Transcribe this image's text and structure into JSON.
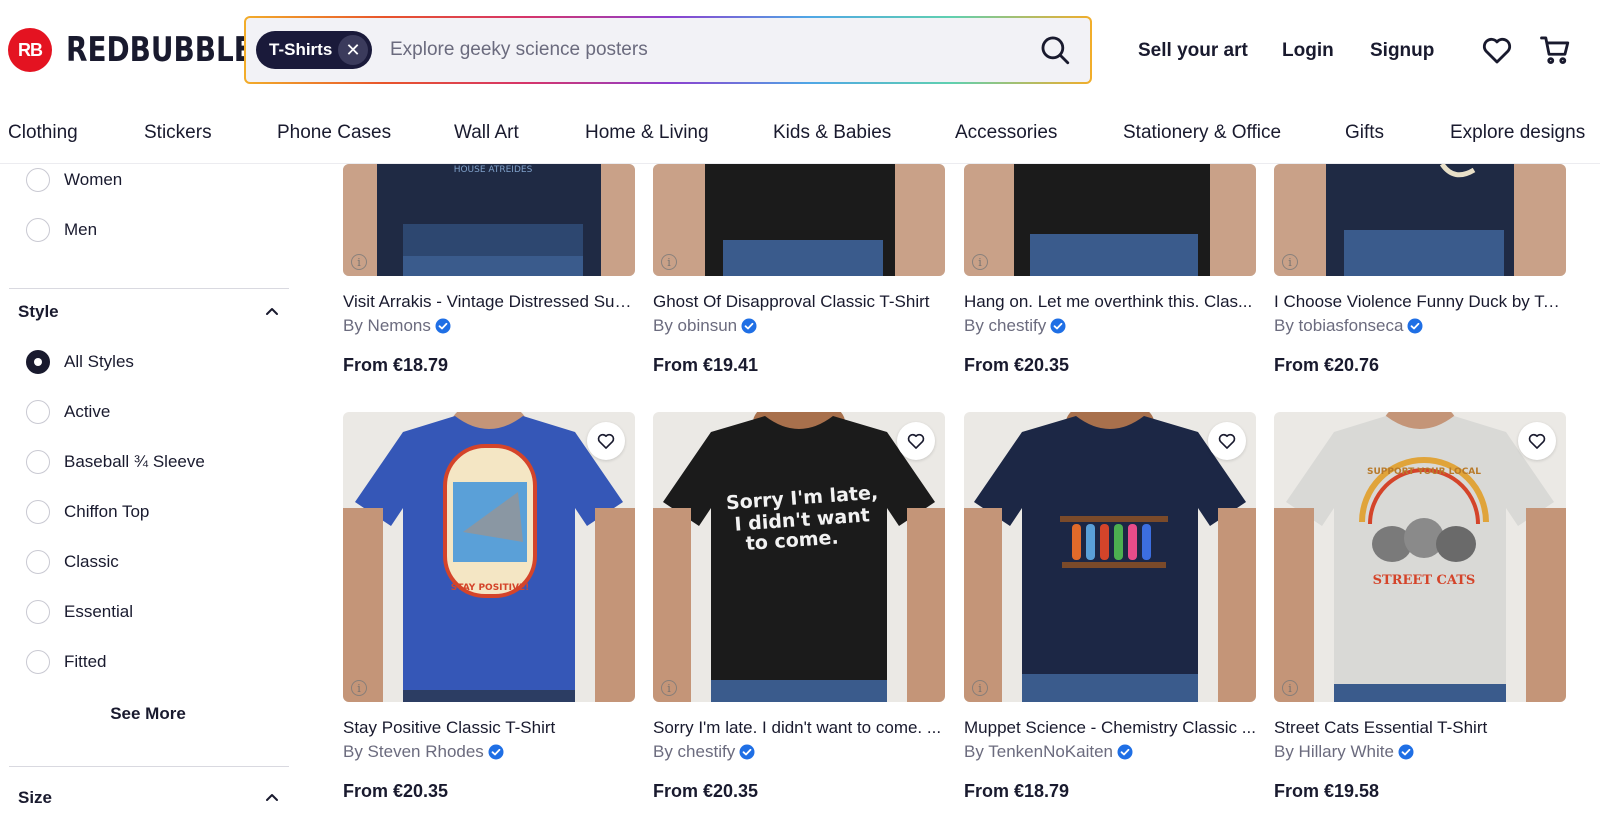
{
  "brand": {
    "logo_mark": "RB",
    "name": "REDBUBBLE",
    "color": "#e41321"
  },
  "search": {
    "chip_label": "T-Shirts",
    "placeholder": "Explore geeky science posters",
    "value": ""
  },
  "header_links": {
    "sell": "Sell your art",
    "login": "Login",
    "signup": "Signup"
  },
  "header_icons": [
    "heart-icon",
    "cart-icon"
  ],
  "categories": [
    "Clothing",
    "Stickers",
    "Phone Cases",
    "Wall Art",
    "Home & Living",
    "Kids & Babies",
    "Accessories",
    "Stationery & Office",
    "Gifts",
    "Explore designs"
  ],
  "sidebar": {
    "gender_options": [
      {
        "label": "Women",
        "checked": false
      },
      {
        "label": "Men",
        "checked": false
      }
    ],
    "style_section": {
      "title": "Style",
      "options": [
        {
          "label": "All Styles",
          "checked": true
        },
        {
          "label": "Active",
          "checked": false
        },
        {
          "label": "Baseball ¾ Sleeve",
          "checked": false
        },
        {
          "label": "Chiffon Top",
          "checked": false
        },
        {
          "label": "Classic",
          "checked": false
        },
        {
          "label": "Essential",
          "checked": false
        },
        {
          "label": "Fitted",
          "checked": false
        }
      ],
      "see_more": "See More"
    },
    "size_section": {
      "title": "Size"
    }
  },
  "products": [
    {
      "title": "Visit Arrakis - Vintage Distressed Surf...",
      "artist": "By Nemons",
      "price": "From €18.79",
      "shirt_color": "#1f2a44"
    },
    {
      "title": "Ghost Of Disapproval Classic T-Shirt",
      "artist": "By obinsun",
      "price": "From €19.41",
      "shirt_color": "#1b1b1b"
    },
    {
      "title": "Hang on. Let me overthink this. Clas...",
      "artist": "By chestify",
      "price": "From €20.35",
      "shirt_color": "#1b1b1b"
    },
    {
      "title": "I Choose Violence Funny Duck by To...",
      "artist": "By tobiasfonseca",
      "price": "From €20.76",
      "shirt_color": "#1f2a44"
    },
    {
      "title": "Stay Positive Classic T-Shirt",
      "artist": "By Steven Rhodes",
      "price": "From €20.35",
      "shirt_color": "#3557b7",
      "print_text": "STAY POSITIVE!"
    },
    {
      "title": "Sorry I'm late. I didn't want to come. ...",
      "artist": "By chestify",
      "price": "From €20.35",
      "shirt_color": "#1b1b1b",
      "print_text": "Sorry I'm late, I didn't want to come."
    },
    {
      "title": "Muppet Science - Chemistry Classic ...",
      "artist": "By TenkenNoKaiten",
      "price": "From €18.79",
      "shirt_color": "#1c2745"
    },
    {
      "title": "Street Cats Essential T-Shirt",
      "artist": "By Hillary White",
      "price": "From €19.58",
      "shirt_color": "#d9d9d6",
      "print_text": "SUPPORT YOUR LOCAL STREET CATS"
    }
  ],
  "colors": {
    "ink": "#191a2e",
    "muted": "#6b6b7e",
    "verified": "#1f6fe5"
  }
}
